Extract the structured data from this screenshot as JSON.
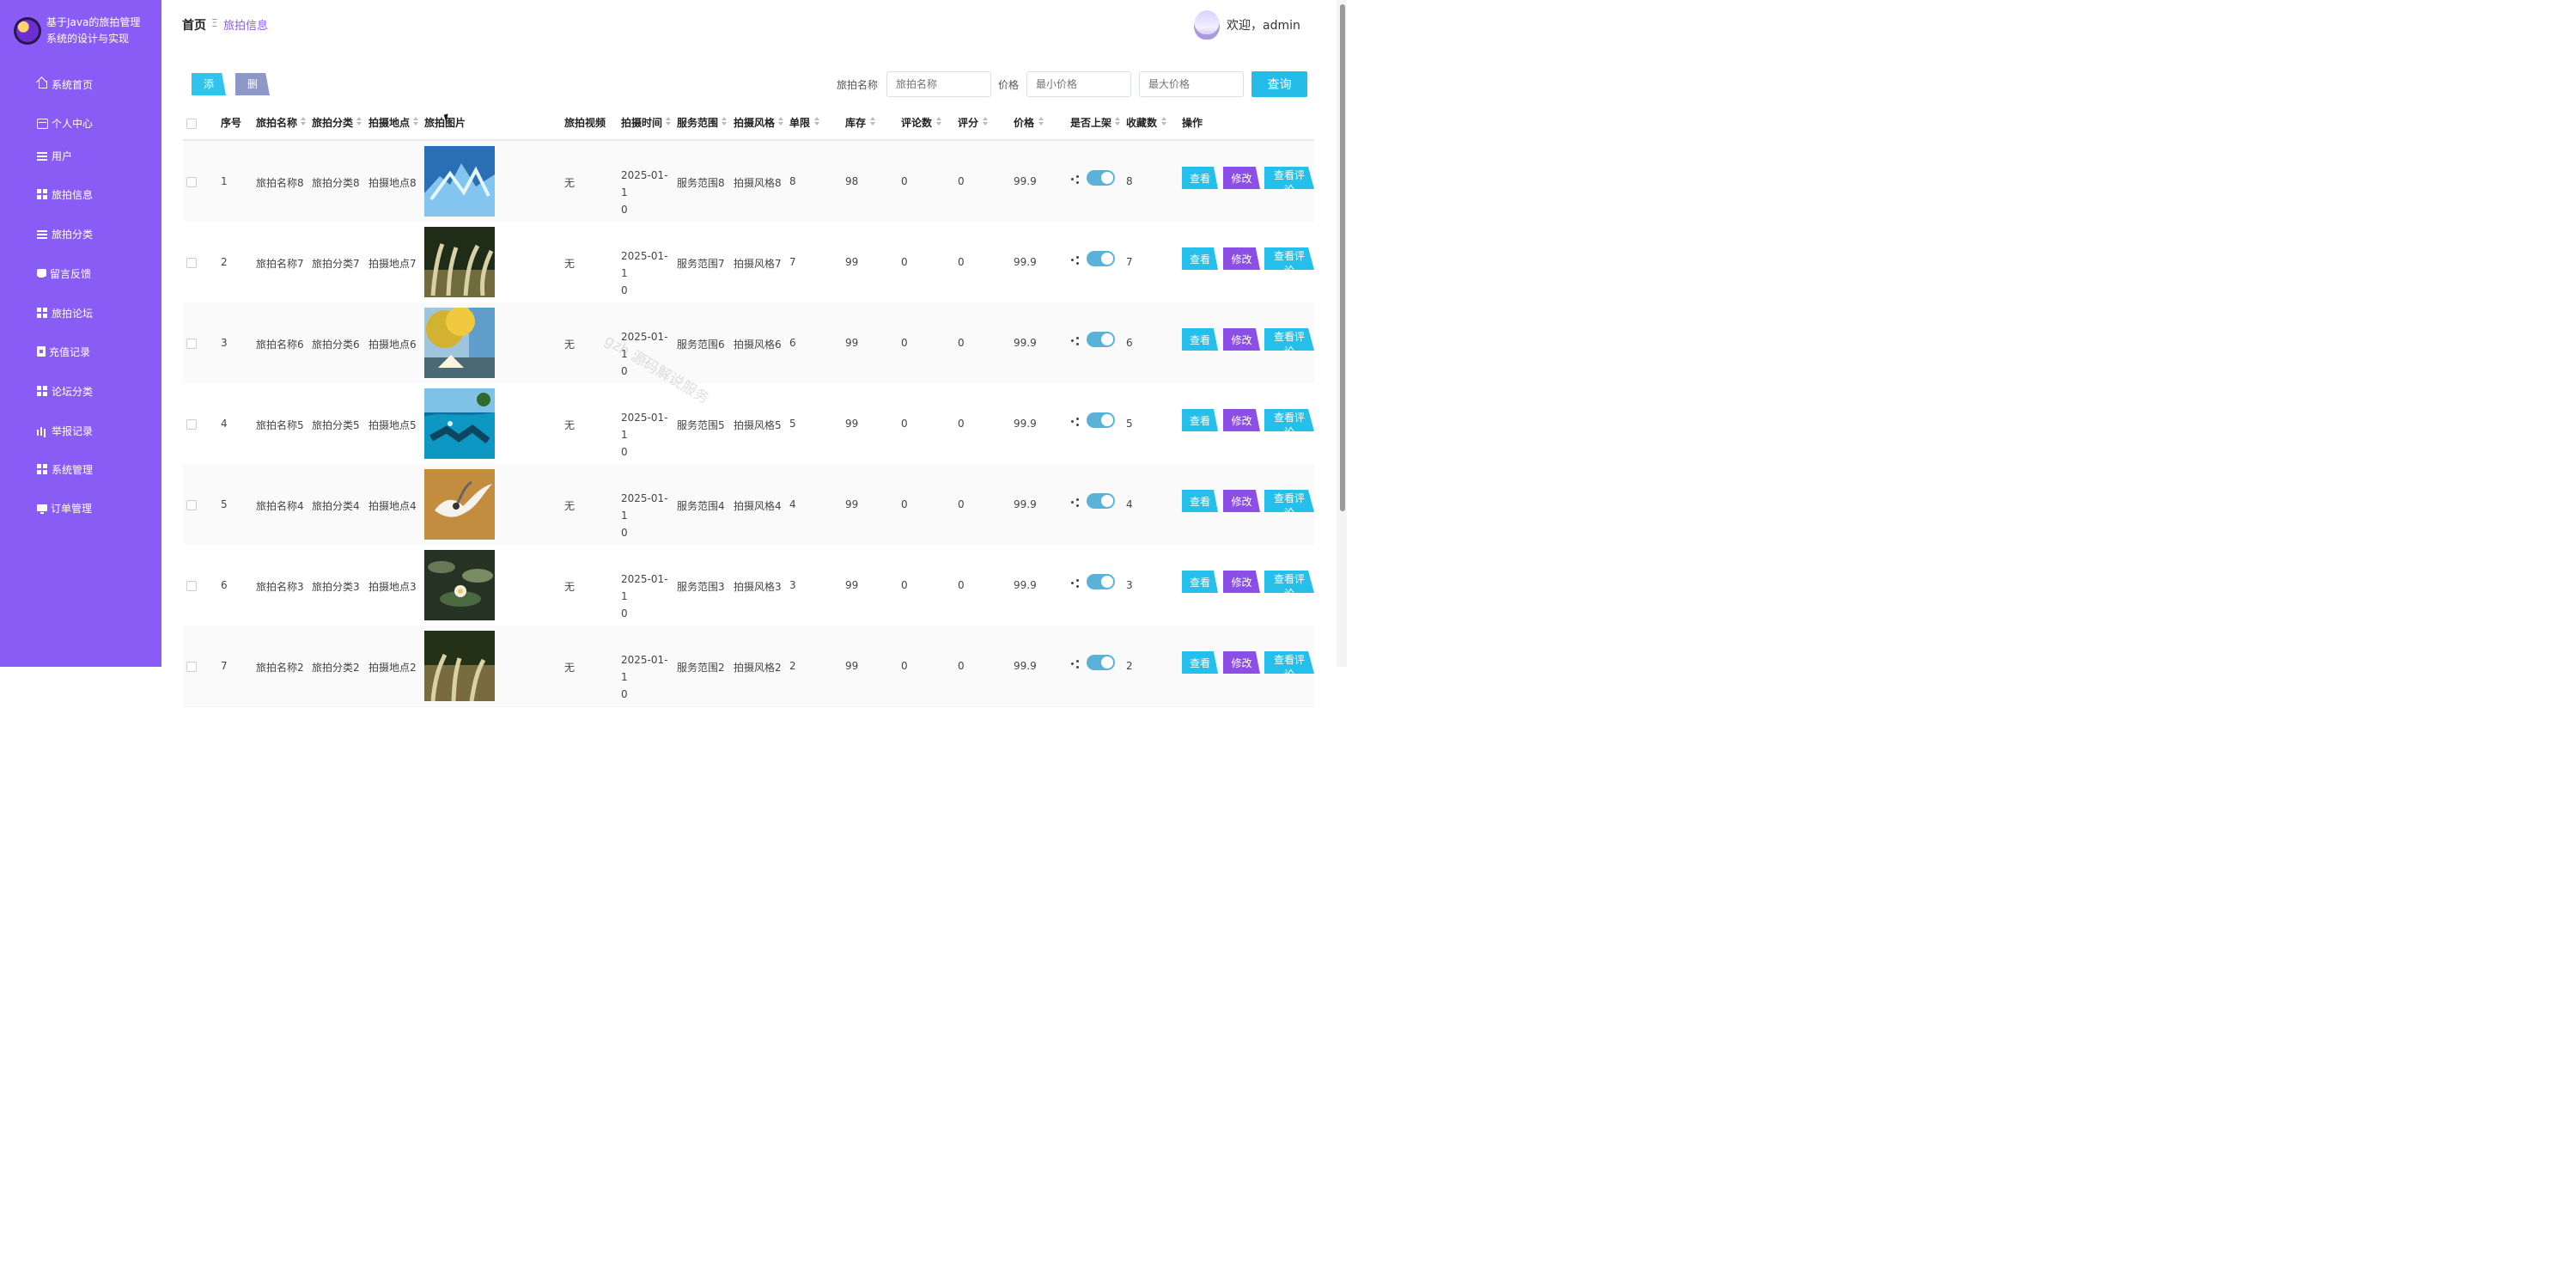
{
  "app": {
    "title_lines": [
      "基于Java的旅拍管理",
      "系统的设计与实现"
    ]
  },
  "sidebar": {
    "items": [
      {
        "label": "系统首页",
        "icon": "home-icon"
      },
      {
        "label": "个人中心",
        "icon": "card-icon"
      },
      {
        "label": "用户",
        "icon": "list-icon"
      },
      {
        "label": "旅拍信息",
        "icon": "grid-icon"
      },
      {
        "label": "旅拍分类",
        "icon": "list-icon"
      },
      {
        "label": "留言反馈",
        "icon": "chat-icon"
      },
      {
        "label": "旅拍论坛",
        "icon": "grid-icon"
      },
      {
        "label": "充值记录",
        "icon": "clipboard-icon"
      },
      {
        "label": "论坛分类",
        "icon": "grid-icon"
      },
      {
        "label": "举报记录",
        "icon": "bar-chart-icon"
      },
      {
        "label": "系统管理",
        "icon": "grid-icon"
      },
      {
        "label": "订单管理",
        "icon": "monitor-icon"
      }
    ]
  },
  "header": {
    "breadcrumb_home": "首页",
    "breadcrumb_separator": "Ξ",
    "breadcrumb_current": "旅拍信息",
    "welcome_text": "欢迎，admin"
  },
  "toolbar": {
    "add_label": "添加",
    "delete_label": "删除",
    "name_label": "旅拍名称",
    "name_placeholder": "旅拍名称",
    "price_label": "价格",
    "min_price_placeholder": "最小价格",
    "max_price_placeholder": "最大价格",
    "query_label": "查询"
  },
  "table": {
    "columns": {
      "index": "序号",
      "name": "旅拍名称",
      "category": "旅拍分类",
      "location": "拍摄地点",
      "photo": "旅拍图片",
      "video": "旅拍视频",
      "shoot_time": "拍摄时间",
      "service_area": "服务范围",
      "style": "拍摄风格",
      "limit": "单限",
      "stock": "库存",
      "comments": "评论数",
      "rating": "评分",
      "price": "价格",
      "listed": "是否上架",
      "favorites": "收藏数",
      "actions": "操作"
    },
    "action_labels": {
      "view": "查看",
      "edit": "修改",
      "comments": "查看评论"
    },
    "rows": [
      {
        "index": "1",
        "name": "旅拍名称8",
        "category": "旅拍分类8",
        "location": "拍摄地点8",
        "video": "无",
        "date_line1": "2025-01-1",
        "date_line2": "0",
        "service_area": "服务范围8",
        "style": "拍摄风格8",
        "limit": "8",
        "stock": "98",
        "comments": "0",
        "rating": "0",
        "price": "99.9",
        "listed": true,
        "favorites": "8"
      },
      {
        "index": "2",
        "name": "旅拍名称7",
        "category": "旅拍分类7",
        "location": "拍摄地点7",
        "video": "无",
        "date_line1": "2025-01-1",
        "date_line2": "0",
        "service_area": "服务范围7",
        "style": "拍摄风格7",
        "limit": "7",
        "stock": "99",
        "comments": "0",
        "rating": "0",
        "price": "99.9",
        "listed": true,
        "favorites": "7"
      },
      {
        "index": "3",
        "name": "旅拍名称6",
        "category": "旅拍分类6",
        "location": "拍摄地点6",
        "video": "无",
        "date_line1": "2025-01-1",
        "date_line2": "0",
        "service_area": "服务范围6",
        "style": "拍摄风格6",
        "limit": "6",
        "stock": "99",
        "comments": "0",
        "rating": "0",
        "price": "99.9",
        "listed": true,
        "favorites": "6"
      },
      {
        "index": "4",
        "name": "旅拍名称5",
        "category": "旅拍分类5",
        "location": "拍摄地点5",
        "video": "无",
        "date_line1": "2025-01-1",
        "date_line2": "0",
        "service_area": "服务范围5",
        "style": "拍摄风格5",
        "limit": "5",
        "stock": "99",
        "comments": "0",
        "rating": "0",
        "price": "99.9",
        "listed": true,
        "favorites": "5"
      },
      {
        "index": "5",
        "name": "旅拍名称4",
        "category": "旅拍分类4",
        "location": "拍摄地点4",
        "video": "无",
        "date_line1": "2025-01-1",
        "date_line2": "0",
        "service_area": "服务范围4",
        "style": "拍摄风格4",
        "limit": "4",
        "stock": "99",
        "comments": "0",
        "rating": "0",
        "price": "99.9",
        "listed": true,
        "favorites": "4"
      },
      {
        "index": "6",
        "name": "旅拍名称3",
        "category": "旅拍分类3",
        "location": "拍摄地点3",
        "video": "无",
        "date_line1": "2025-01-1",
        "date_line2": "0",
        "service_area": "服务范围3",
        "style": "拍摄风格3",
        "limit": "3",
        "stock": "99",
        "comments": "0",
        "rating": "0",
        "price": "99.9",
        "listed": true,
        "favorites": "3"
      },
      {
        "index": "7",
        "name": "旅拍名称2",
        "category": "旅拍分类2",
        "location": "拍摄地点2",
        "video": "无",
        "date_line1": "2025-01-1",
        "date_line2": "0",
        "service_area": "服务范围2",
        "style": "拍摄风格2",
        "limit": "2",
        "stock": "99",
        "comments": "0",
        "rating": "0",
        "price": "99.9",
        "listed": true,
        "favorites": "2"
      }
    ]
  },
  "watermark": "gzh 源码解说服务",
  "colors": {
    "sidebar": "#8a5cf6",
    "primary_button": "#24bdea",
    "edit_button": "#8b4fe8",
    "delete_button": "#8e98c7",
    "toggle_on": "#5bb2d8"
  }
}
